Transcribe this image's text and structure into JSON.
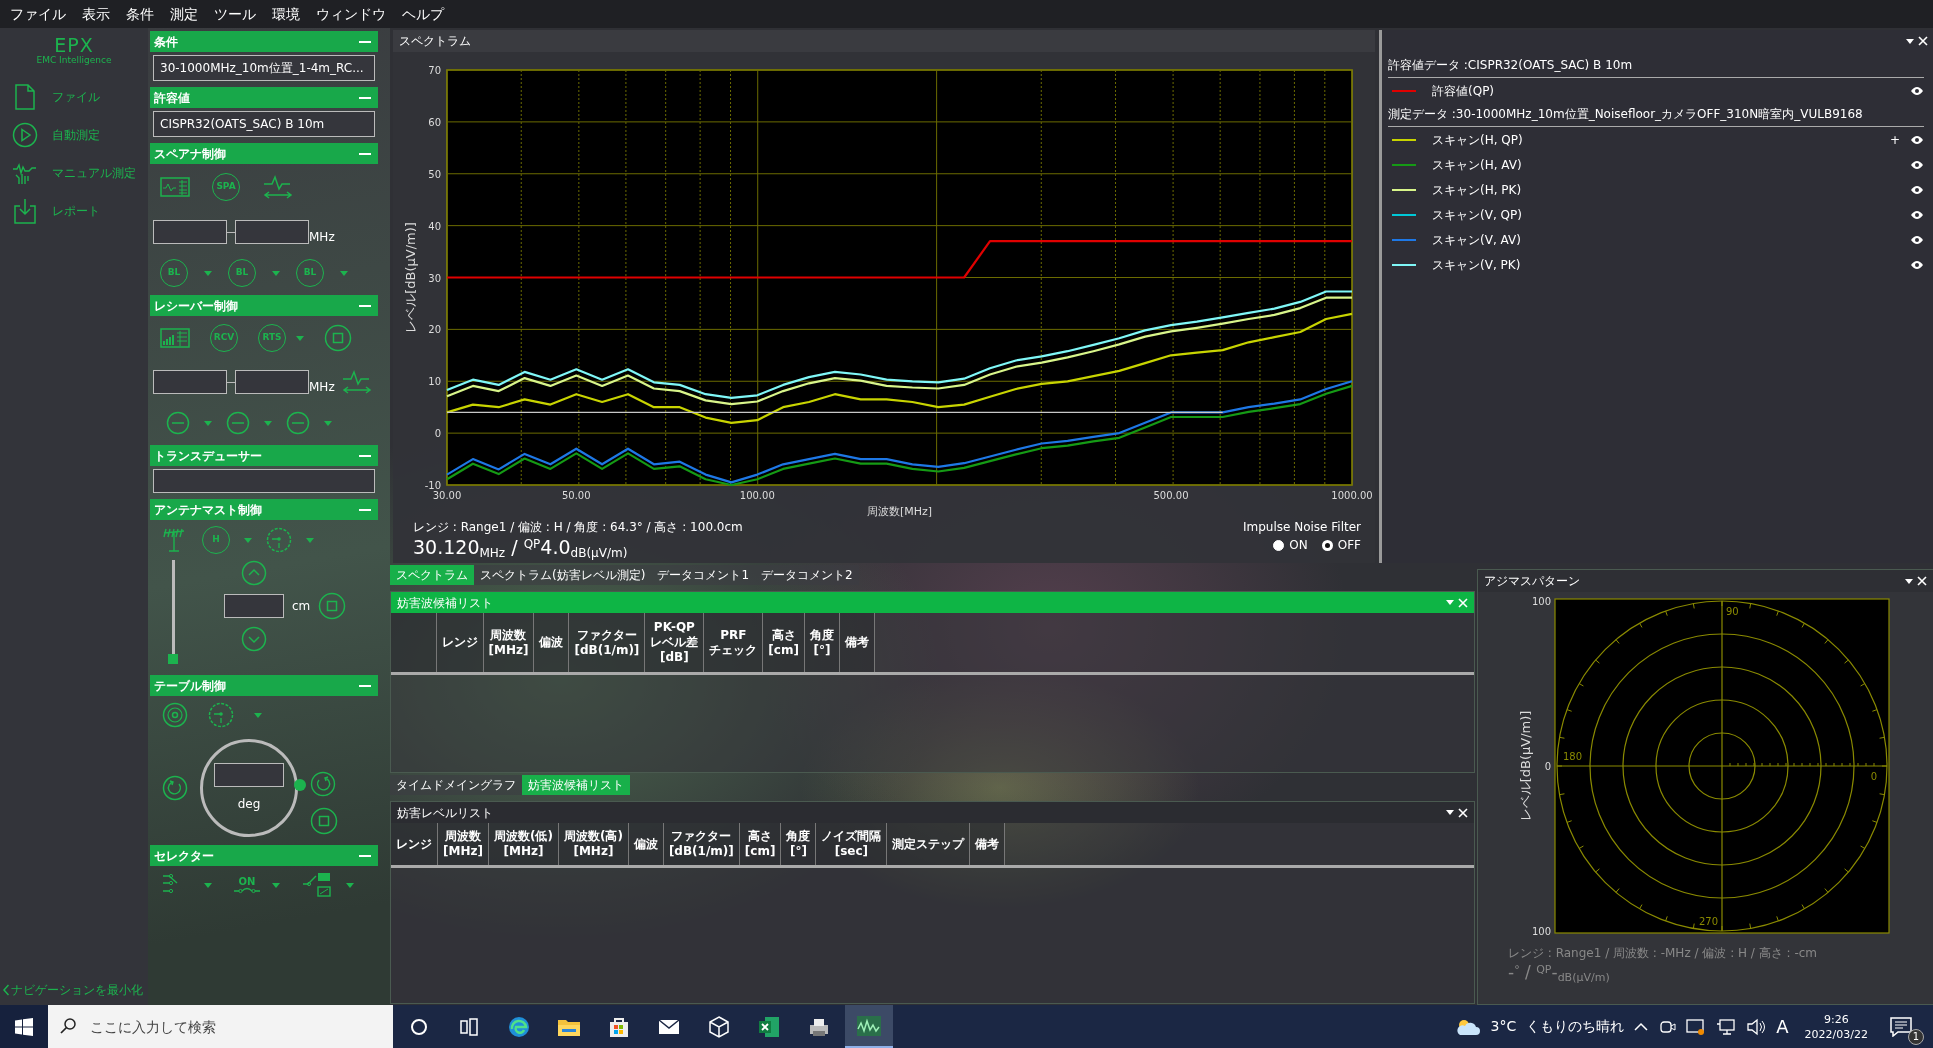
{
  "menu": [
    "ファイル",
    "表示",
    "条件",
    "測定",
    "ツール",
    "環境",
    "ウィンドウ",
    "ヘルプ"
  ],
  "navigation": {
    "logo": "EPX",
    "logo_tagline": "EMC Intelligence",
    "items": [
      {
        "kind": "file",
        "label": "ファイル"
      },
      {
        "kind": "auto",
        "label": "自動測定"
      },
      {
        "kind": "manual",
        "label": "マニュアル測定"
      },
      {
        "kind": "report",
        "label": "レポート"
      }
    ],
    "minimize": "ナビゲーションを最小化"
  },
  "control_panel": {
    "sections": [
      {
        "kind": "select",
        "title": "条件",
        "value": "30-1000MHz_10m位置_1-4m_RC..."
      },
      {
        "kind": "select",
        "title": "許容値",
        "value": "CISPR32(OATS_SAC) B 10m"
      },
      {
        "kind": "analyzer",
        "title": "スペアナ制御",
        "mode_label": "SPA",
        "unit": "MHz",
        "baseline_labels": [
          "BL",
          "BL",
          "BL"
        ]
      },
      {
        "kind": "receiver",
        "title": "レシーバー制御",
        "mode_labels": [
          "RCV",
          "RTS"
        ],
        "unit": "MHz"
      },
      {
        "kind": "field",
        "title": "トランスデューサー"
      },
      {
        "kind": "mast",
        "title": "アンテナマスト制御",
        "polarization": "H",
        "unit": "cm",
        "level": 0
      },
      {
        "kind": "turntable",
        "title": "テーブル制御",
        "unit": "deg"
      },
      {
        "kind": "selector",
        "title": "セレクター",
        "switch_label": "ON"
      }
    ]
  },
  "spectrum": {
    "title": "スペクトラム",
    "chart_data": {
      "type": "line",
      "xlabel": "周波数[MHz]",
      "ylabel": "レベル[dB(µV/m)]",
      "categories": [
        "30.00",
        null,
        null,
        null,
        null,
        "50.00",
        null,
        null,
        null,
        null,
        null,
        null,
        "100.00",
        null,
        null,
        null,
        null,
        null,
        null,
        null,
        null,
        null,
        null,
        null,
        null,
        null,
        null,
        null,
        "500.00",
        null,
        null,
        null,
        null,
        null,
        null,
        "1000.00"
      ],
      "series": [
        {
          "name": "許容値(QP)",
          "color": "#e00000",
          "values": [
            30,
            30,
            30,
            30,
            30,
            30,
            30,
            30,
            30,
            30,
            30,
            30,
            30,
            30,
            30,
            30,
            30,
            30,
            30,
            30,
            30,
            37,
            37,
            37,
            37,
            37,
            37,
            37,
            37,
            37,
            37,
            37,
            37,
            37,
            37,
            37
          ]
        },
        {
          "name": "スキャン(H, QP)",
          "color": "#c8d400",
          "values": [
            4,
            5.5,
            5,
            6.5,
            5.5,
            7.5,
            6,
            7.5,
            5,
            5,
            3,
            2,
            2.5,
            5,
            6,
            7.5,
            6.5,
            6.5,
            6,
            5,
            5.5,
            7,
            8.5,
            9.5,
            10,
            11,
            12,
            13.5,
            15,
            15.5,
            16,
            17.5,
            18.5,
            19.5,
            22,
            23
          ]
        },
        {
          "name": "スキャン(H, AV)",
          "color": "#159a15",
          "values": [
            -8.9,
            -5.9,
            -7.9,
            -4.9,
            -6.9,
            -3.9,
            -6.9,
            -3.9,
            -6.9,
            -6.4,
            -8.9,
            -10,
            -8.9,
            -6.9,
            -5.9,
            -4.9,
            -5.9,
            -5.9,
            -6.9,
            -7.4,
            -6.7,
            -5.4,
            -4.1,
            -2.9,
            -2.4,
            -1.6,
            -0.9,
            1.1,
            3.1,
            3.1,
            3.1,
            4.1,
            4.8,
            5.6,
            7.6,
            9.1
          ]
        },
        {
          "name": "スキャン(H, PK)",
          "color": "#d8f58a",
          "values": [
            7.1,
            9.1,
            8.1,
            10.6,
            9.1,
            11.1,
            9.1,
            11.1,
            8.6,
            8.1,
            6.3,
            5.6,
            6.1,
            8.1,
            9.6,
            10.6,
            10.1,
            9.1,
            8.8,
            8.6,
            9.3,
            11.3,
            12.8,
            13.6,
            14.6,
            15.8,
            17.1,
            18.6,
            19.6,
            20.3,
            21.1,
            22,
            22.8,
            24.1,
            26.1,
            26.1
          ]
        },
        {
          "name": "スキャン(V, QP)",
          "color": "#00c8d8",
          "values": [
            null,
            null,
            null,
            null,
            null,
            null,
            null,
            null,
            null,
            null,
            null,
            null,
            null,
            null,
            null,
            null,
            null,
            null,
            null,
            null,
            null,
            null,
            null,
            null,
            null,
            null,
            null,
            null,
            null,
            null,
            null,
            null,
            null,
            null,
            null,
            null
          ]
        },
        {
          "name": "スキャン(V, AV)",
          "color": "#1e78e6",
          "values": [
            -8,
            -5,
            -7,
            -4,
            -6,
            -3,
            -6,
            -3,
            -6,
            -5.5,
            -8,
            -9.5,
            -8,
            -6,
            -5,
            -4,
            -5,
            -5,
            -6,
            -6.5,
            -5.8,
            -4.5,
            -3.2,
            -2,
            -1.5,
            -0.7,
            0,
            2,
            4,
            4,
            4,
            5,
            5.7,
            6.5,
            8.5,
            10
          ]
        },
        {
          "name": "スキャン(V, PK)",
          "color": "#7ff7f7",
          "values": [
            8.3,
            10.3,
            9.3,
            11.8,
            10.3,
            12.3,
            10.3,
            12.3,
            9.8,
            9.3,
            7.5,
            6.8,
            7.3,
            9.3,
            10.8,
            11.8,
            11.3,
            10.3,
            10,
            9.8,
            10.5,
            12.5,
            14,
            14.8,
            15.8,
            17,
            18.3,
            19.8,
            20.8,
            21.5,
            22.3,
            23.2,
            24,
            25.3,
            27.3,
            27.3
          ]
        },
        {
          "color": "#c8c8c8",
          "values": [
            4,
            4,
            4,
            4,
            4,
            4,
            4,
            4,
            4,
            4,
            4,
            4,
            4,
            4,
            4,
            4,
            4,
            4,
            4,
            4,
            4,
            4,
            4,
            4,
            4,
            4,
            4,
            4,
            4,
            4,
            4,
            null,
            null,
            null,
            null,
            null
          ]
        }
      ],
      "ylim": [
        -10,
        70
      ],
      "grid": true,
      "yticks": [
        -10,
        0,
        10,
        20,
        30,
        40,
        50,
        60,
        70
      ]
    },
    "info": "レンジ : Range1 / 偏波 : H / 角度 : 64.3° / 高さ : 100.0cm",
    "reading": "30.120$_{MHz}$ / $^{QP}$4.0$_{dB(µV/m)}$",
    "filter": {
      "label": "Impulse Noise Filter",
      "options": [
        {
          "label": "ON",
          "selected": false
        },
        {
          "label": "OFF",
          "selected": true
        }
      ]
    }
  },
  "legend": {
    "groups": [
      {
        "header": "許容値データ :CISPR32(OATS_SAC) B 10m",
        "items": [
          {
            "visible": true
          }
        ]
      },
      {
        "header": "測定データ :30-1000MHz_10m位置_Noisefloor_カメラOFF_310N暗室内_VULB9168",
        "items": [
          {
            "visible": true,
            "extra": "+"
          },
          {
            "visible": true
          },
          {
            "visible": true
          },
          {
            "visible": true
          },
          {
            "visible": true
          },
          {
            "visible": true
          }
        ]
      }
    ]
  },
  "tabs_top": [
    {
      "label": "スペクトラム",
      "selected": true
    },
    {
      "label": "スペクトラム(妨害レベル測定)",
      "selected": false
    },
    {
      "label": "データコメント1",
      "selected": false
    },
    {
      "label": "データコメント2",
      "selected": false
    }
  ],
  "candidate_table": {
    "title": "妨害波候補リスト",
    "active": true,
    "row_header": true,
    "columns": [
      "レンジ",
      "周波数\n[MHz]",
      "偏波",
      "ファクター\n[dB(1/m)]",
      "PK-QP\nレベル差\n[dB]",
      "PRF\nチェック",
      "高さ\n[cm]",
      "角度\n[°]",
      "備考"
    ]
  },
  "tabs_bottom": [
    {
      "label": "タイムドメイングラフ",
      "selected": false
    },
    {
      "label": "妨害波候補リスト",
      "selected": true
    }
  ],
  "level_table": {
    "title": "妨害レベルリスト",
    "active": false,
    "row_header": false,
    "columns": [
      "レンジ",
      "周波数\n[MHz]",
      "周波数(低)\n[MHz]",
      "周波数(高)\n[MHz]",
      "偏波",
      "ファクター\n[dB(1/m)]",
      "高さ\n[cm]",
      "角度\n[°]",
      "ノイズ間隔\n[sec]",
      "測定ステップ",
      "備考"
    ]
  },
  "azimuth": {
    "title": "アジマスパターン",
    "ylabel": "レベル[dB(µV/m)]",
    "r_labels": [
      "100",
      "0",
      "100"
    ],
    "angle_labels": [
      "90",
      "180",
      "270",
      "0"
    ],
    "info": "レンジ : Range1 / 周波数 : -MHz / 偏波 : H / 高さ : -cm",
    "reading": "-$^{°}$ / $^{QP}$-$_{dB(µV/m)}$"
  },
  "taskbar": {
    "search_placeholder": "ここに入力して検索",
    "apps": [
      {
        "kind": "cortana",
        "selected": false
      },
      {
        "kind": "taskview",
        "selected": false
      },
      {
        "kind": "edge",
        "selected": false
      },
      {
        "kind": "explorer",
        "selected": false
      },
      {
        "kind": "store",
        "selected": false
      },
      {
        "kind": "mail",
        "selected": false
      },
      {
        "kind": "cube",
        "selected": false
      },
      {
        "kind": "excel",
        "selected": false
      },
      {
        "kind": "printer",
        "selected": false
      },
      {
        "kind": "epx",
        "selected": true
      }
    ],
    "temperature": "3°C",
    "weather": "くもりのち晴れ",
    "ime": "A",
    "time": "9:26",
    "date": "2022/03/22",
    "notifications": "1"
  }
}
